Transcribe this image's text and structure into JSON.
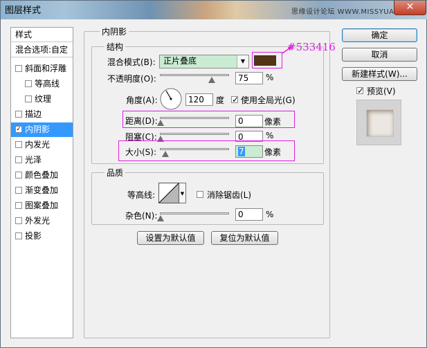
{
  "window": {
    "title": "图层样式",
    "watermark": "思缘设计论坛 WWW.MISSYUAN.COM",
    "close_glyph": "✕"
  },
  "sidebar": {
    "header": "样式",
    "blend_options": "混合选项:自定",
    "items": [
      {
        "label": "斜面和浮雕",
        "checked": false,
        "sub": false,
        "selected": false
      },
      {
        "label": "等高线",
        "checked": false,
        "sub": true,
        "selected": false
      },
      {
        "label": "纹理",
        "checked": false,
        "sub": true,
        "selected": false
      },
      {
        "label": "描边",
        "checked": false,
        "sub": false,
        "selected": false
      },
      {
        "label": "内阴影",
        "checked": true,
        "sub": false,
        "selected": true
      },
      {
        "label": "内发光",
        "checked": false,
        "sub": false,
        "selected": false
      },
      {
        "label": "光泽",
        "checked": false,
        "sub": false,
        "selected": false
      },
      {
        "label": "颜色叠加",
        "checked": false,
        "sub": false,
        "selected": false
      },
      {
        "label": "渐变叠加",
        "checked": false,
        "sub": false,
        "selected": false
      },
      {
        "label": "图案叠加",
        "checked": false,
        "sub": false,
        "selected": false
      },
      {
        "label": "外发光",
        "checked": false,
        "sub": false,
        "selected": false
      },
      {
        "label": "投影",
        "checked": false,
        "sub": false,
        "selected": false
      }
    ]
  },
  "main": {
    "section_title": "内阴影",
    "structure": {
      "title": "结构",
      "blend_mode_label": "混合模式(B):",
      "blend_mode_value": "正片叠底",
      "color": "#533416",
      "color_annotation": "#533416",
      "opacity_label": "不透明度(O):",
      "opacity_value": "75",
      "opacity_unit": "%",
      "opacity_level": 0.75,
      "angle_label": "角度(A):",
      "angle_value": "120",
      "angle_unit": "度",
      "global_light_label": "使用全局光(G)",
      "global_light_checked": true,
      "distance_label": "距离(D):",
      "distance_value": "0",
      "distance_unit": "像素",
      "choke_label": "阻塞(C):",
      "choke_value": "0",
      "choke_unit": "%",
      "size_label": "大小(S):",
      "size_value": "7",
      "size_unit": "像素"
    },
    "quality": {
      "title": "品质",
      "contour_label": "等高线:",
      "antialias_label": "消除锯齿(L)",
      "antialias_checked": false,
      "noise_label": "杂色(N):",
      "noise_value": "0",
      "noise_unit": "%"
    },
    "set_default_label": "设置为默认值",
    "reset_default_label": "复位为默认值"
  },
  "right": {
    "ok_label": "确定",
    "cancel_label": "取消",
    "new_style_label": "新建样式(W)...",
    "preview_label": "预览(V)",
    "preview_checked": true
  }
}
